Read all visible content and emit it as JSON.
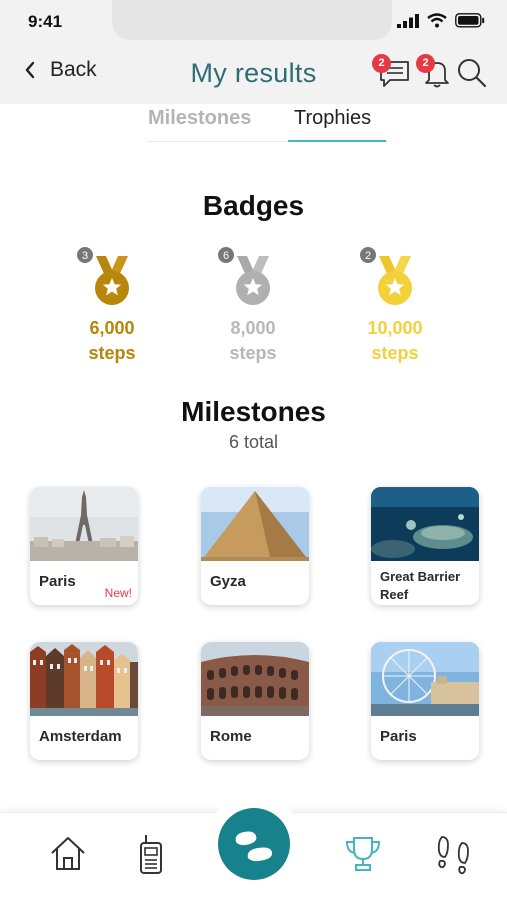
{
  "status": {
    "time": "9:41"
  },
  "header": {
    "back_label": "Back",
    "title": "My results",
    "messages_count": "2",
    "notifications_count": "2"
  },
  "tabs": [
    {
      "label": "Milestones",
      "active": false
    },
    {
      "label": "Trophies",
      "active": true
    }
  ],
  "badges": {
    "title": "Badges",
    "items": [
      {
        "count": "3",
        "value": "6,000",
        "unit": "steps",
        "color": "#b8860b"
      },
      {
        "count": "6",
        "value": "8,000",
        "unit": "steps",
        "color": "#b0b0b0"
      },
      {
        "count": "2",
        "value": "10,000",
        "unit": "steps",
        "color": "#f2d13b"
      }
    ]
  },
  "milestones": {
    "title": "Milestones",
    "subtitle": "6 total",
    "items": [
      {
        "label": "Paris",
        "tag": "New!",
        "image": "eiffel-tower"
      },
      {
        "label": "Gyza",
        "tag": "",
        "image": "pyramid"
      },
      {
        "label": "Great Barrier Reef",
        "tag": "",
        "image": "coral-reef"
      },
      {
        "label": "Amsterdam",
        "tag": "",
        "image": "canal-houses"
      },
      {
        "label": "Rome",
        "tag": "",
        "image": "colosseum"
      },
      {
        "label": "Paris",
        "tag": "",
        "image": "ferris-wheel"
      }
    ]
  },
  "nav": {
    "items": [
      "home-icon",
      "walkie-talkie-icon",
      "footsteps-icon",
      "trophy-icon",
      "footprints-icon"
    ],
    "active": "trophy-icon",
    "accent": "#17828c"
  }
}
